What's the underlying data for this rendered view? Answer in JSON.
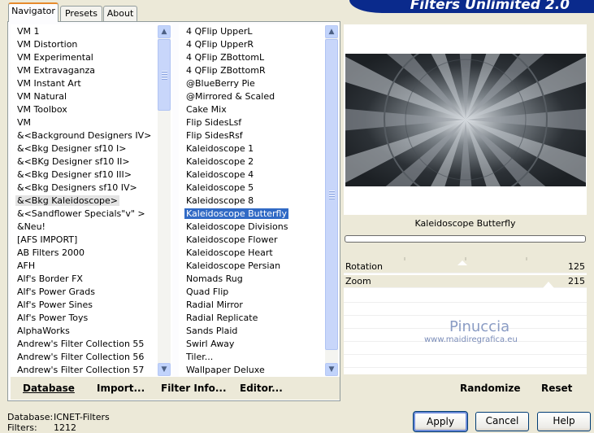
{
  "banner": {
    "title": "Filters Unlimited 2.0"
  },
  "tabs": [
    {
      "label": "Navigator",
      "active": true
    },
    {
      "label": "Presets",
      "active": false
    },
    {
      "label": "About",
      "active": false
    }
  ],
  "categories": {
    "items": [
      "VM 1",
      "VM Distortion",
      "VM Experimental",
      "VM Extravaganza",
      "VM Instant Art",
      "VM Natural",
      "VM Toolbox",
      "VM",
      "&<Background Designers IV>",
      "&<Bkg Designer sf10 I>",
      "&<BKg Designer sf10 II>",
      "&<Bkg Designer sf10 III>",
      "&<Bkg Designers sf10 IV>",
      "&<Bkg Kaleidoscope>",
      "&<Sandflower Specials\"v\" >",
      "&Neu!",
      "[AFS IMPORT]",
      "AB Filters 2000",
      "AFH",
      "Alf's Border FX",
      "Alf's Power Grads",
      "Alf's Power Sines",
      "Alf's Power Toys",
      "AlphaWorks",
      "Andrew's Filter Collection 55",
      "Andrew's Filter Collection 56",
      "Andrew's Filter Collection 57"
    ],
    "focused_index": 13
  },
  "filters": {
    "items": [
      "4 QFlip UpperL",
      "4 QFlip UpperR",
      "4 QFlip ZBottomL",
      "4 QFlip ZBottomR",
      "@BlueBerry Pie",
      "@Mirrored & Scaled",
      "Cake Mix",
      "Flip SidesLsf",
      "Flip SidesRsf",
      "Kaleidoscope 1",
      "Kaleidoscope 2",
      "Kaleidoscope 4",
      "Kaleidoscope 5",
      "Kaleidoscope 8",
      "Kaleidoscope Butterfly",
      "Kaleidoscope Divisions",
      "Kaleidoscope Flower",
      "Kaleidoscope Heart",
      "Kaleidoscope Persian",
      "Nomads Rug",
      "Quad Flip",
      "Radial Mirror",
      "Radial Replicate",
      "Sands Plaid",
      "Swirl Away",
      "Tiler...",
      "Wallpaper Deluxe"
    ],
    "selected_index": 14
  },
  "toolbar": {
    "database": "Database",
    "import": "Import...",
    "filter_info": "Filter Info...",
    "editor": "Editor..."
  },
  "preview": {
    "filter_name": "Kaleidoscope Butterfly",
    "watermark_title": "Pinuccia",
    "watermark_url": "www.maidiregrafica.eu"
  },
  "params": [
    {
      "label": "Rotation",
      "value": "125"
    },
    {
      "label": "Zoom",
      "value": "215"
    }
  ],
  "right_toolbar": {
    "randomize": "Randomize",
    "reset": "Reset"
  },
  "buttons": {
    "apply": "Apply",
    "cancel": "Cancel",
    "help": "Help"
  },
  "status": {
    "database_label": "Database:",
    "database_value": "ICNET-Filters",
    "filters_label": "Filters:",
    "filters_value": "1212"
  },
  "colors": {
    "selection": "#316AC5",
    "banner": "#0A2A8C",
    "dialog_bg": "#ECE9D8"
  }
}
